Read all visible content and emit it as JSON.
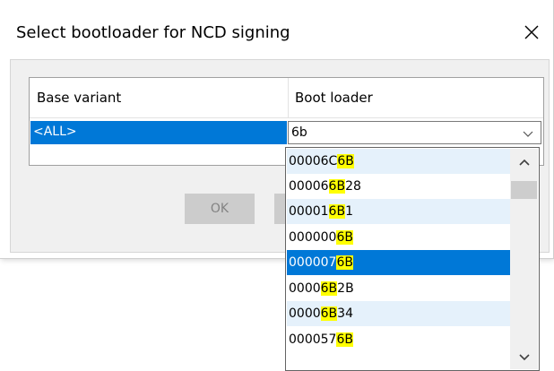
{
  "dialog": {
    "title": "Select bootloader for NCD signing",
    "close_glyph": "✕"
  },
  "grid": {
    "columns": [
      "Base variant",
      "Boot loader"
    ],
    "selected_row": {
      "base_variant": "<ALL>",
      "boot_loader_value": "6b"
    }
  },
  "buttons": {
    "ok_label": "OK"
  },
  "dropdown": {
    "items": [
      {
        "prefix": "00006C",
        "match": "6B",
        "suffix": "",
        "style": "alt"
      },
      {
        "prefix": "00006",
        "match": "B",
        "suffix": "28",
        "style": "normal",
        "match_full": "6B"
      },
      {
        "prefix": "00001",
        "match": "6B",
        "suffix": "1",
        "style": "alt"
      },
      {
        "prefix": "000000",
        "match": "6B",
        "suffix": "",
        "style": "normal"
      },
      {
        "prefix": "000007",
        "match": "6B",
        "suffix": "",
        "style": "selected"
      },
      {
        "prefix": "0000",
        "match": "6B",
        "suffix": "2B",
        "style": "normal"
      },
      {
        "prefix": "0000",
        "match": "6B",
        "suffix": "34",
        "style": "alt"
      },
      {
        "prefix": "000057",
        "match": "6B",
        "suffix": "",
        "style": "normal"
      }
    ]
  },
  "colors": {
    "selection": "#0078d7",
    "highlight": "#ffff00",
    "alt_row": "#e5f1fb"
  }
}
